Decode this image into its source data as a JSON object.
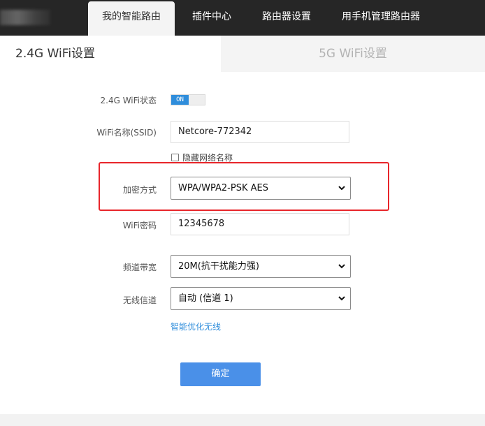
{
  "nav": {
    "tabs": [
      {
        "label": "我的智能路由",
        "active": true
      },
      {
        "label": "插件中心",
        "active": false
      },
      {
        "label": "路由器设置",
        "active": false
      },
      {
        "label": "用手机管理路由器",
        "active": false
      }
    ]
  },
  "subtabs": [
    {
      "label": "2.4G WiFi设置",
      "active": true
    },
    {
      "label": "5G WiFi设置",
      "active": false
    }
  ],
  "form": {
    "status": {
      "label": "2.4G WiFi状态",
      "toggle_text": "ON",
      "on": true
    },
    "ssid": {
      "label": "WiFi名称(SSID)",
      "value": "Netcore-772342"
    },
    "hide_ssid": {
      "label": "隐藏网络名称",
      "checked": false
    },
    "encryption": {
      "label": "加密方式",
      "value": "WPA/WPA2-PSK AES"
    },
    "password": {
      "label": "WiFi密码",
      "value": "12345678"
    },
    "bandwidth": {
      "label": "频道带宽",
      "value": "20M(抗干扰能力强)"
    },
    "channel": {
      "label": "无线信道",
      "value": "自动 (信道 1)"
    },
    "optimize_link": "智能优化无线",
    "confirm": "确定"
  },
  "colors": {
    "nav_bg": "#262626",
    "accent": "#2f8ddb",
    "button": "#4a90e8",
    "highlight_border": "#e8262b"
  }
}
